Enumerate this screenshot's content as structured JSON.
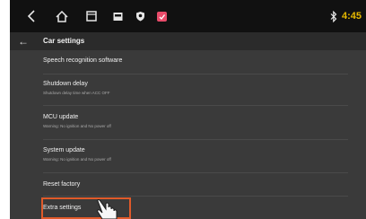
{
  "status_bar": {
    "icons": [
      "back-icon",
      "home-icon",
      "recent-apps-icon",
      "radio-icon",
      "navigation-icon",
      "app-icon",
      "bluetooth-icon"
    ],
    "time": "4:45",
    "bluetooth_color": "#e6e6e6",
    "time_color": "#e6b800"
  },
  "header": {
    "title": "Car settings"
  },
  "settings": {
    "items": [
      {
        "title": "Speech recognition software"
      },
      {
        "title": "Shutdown delay",
        "subtitle": "Shutdown delay time when ACC OFF"
      },
      {
        "title": "MCU update",
        "subtitle": "Warning: No ignition and No power off"
      },
      {
        "title": "System update",
        "subtitle": "Warning: No ignition and No power off"
      },
      {
        "title": "Reset factory"
      },
      {
        "title": "Extra settings"
      }
    ]
  },
  "highlight_color": "#e05a2a"
}
